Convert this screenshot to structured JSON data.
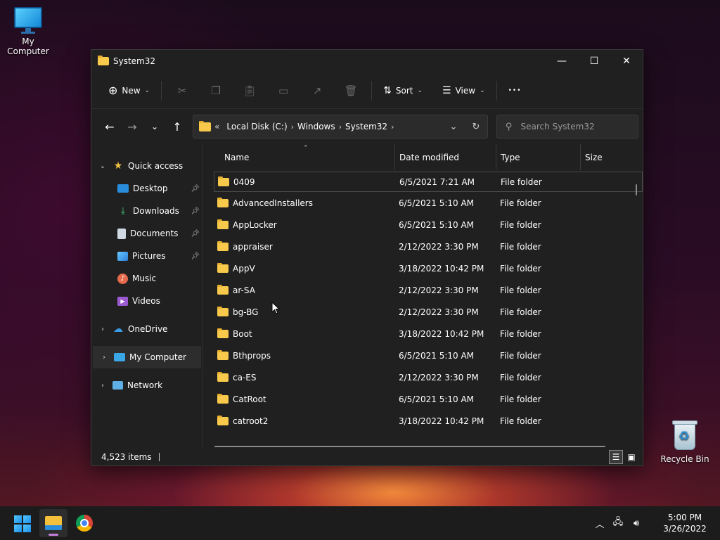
{
  "desktop": {
    "my_computer_label": "My Computer",
    "recycle_bin_label": "Recycle Bin"
  },
  "window": {
    "title": "System32",
    "minimize": "—",
    "maximize": "☐",
    "close": "✕"
  },
  "toolbar": {
    "new_label": "New",
    "sort_label": "Sort",
    "view_label": "View",
    "more_label": "•••"
  },
  "address": {
    "prefix": "«",
    "crumbs": [
      "Local Disk (C:)",
      "Windows",
      "System32"
    ],
    "search_placeholder": "Search System32"
  },
  "sidebar": {
    "quick_access": "Quick access",
    "items": [
      {
        "label": "Desktop"
      },
      {
        "label": "Downloads"
      },
      {
        "label": "Documents"
      },
      {
        "label": "Pictures"
      },
      {
        "label": "Music"
      },
      {
        "label": "Videos"
      }
    ],
    "onedrive": "OneDrive",
    "my_computer": "My Computer",
    "network": "Network"
  },
  "columns": {
    "name": "Name",
    "date": "Date modified",
    "type": "Type",
    "size": "Size"
  },
  "files": [
    {
      "name": "0409",
      "date": "6/5/2021 7:21 AM",
      "type": "File folder"
    },
    {
      "name": "AdvancedInstallers",
      "date": "6/5/2021 5:10 AM",
      "type": "File folder"
    },
    {
      "name": "AppLocker",
      "date": "6/5/2021 5:10 AM",
      "type": "File folder"
    },
    {
      "name": "appraiser",
      "date": "2/12/2022 3:30 PM",
      "type": "File folder"
    },
    {
      "name": "AppV",
      "date": "3/18/2022 10:42 PM",
      "type": "File folder"
    },
    {
      "name": "ar-SA",
      "date": "2/12/2022 3:30 PM",
      "type": "File folder"
    },
    {
      "name": "bg-BG",
      "date": "2/12/2022 3:30 PM",
      "type": "File folder"
    },
    {
      "name": "Boot",
      "date": "3/18/2022 10:42 PM",
      "type": "File folder"
    },
    {
      "name": "Bthprops",
      "date": "6/5/2021 5:10 AM",
      "type": "File folder"
    },
    {
      "name": "ca-ES",
      "date": "2/12/2022 3:30 PM",
      "type": "File folder"
    },
    {
      "name": "CatRoot",
      "date": "6/5/2021 5:10 AM",
      "type": "File folder"
    },
    {
      "name": "catroot2",
      "date": "3/18/2022 10:42 PM",
      "type": "File folder"
    }
  ],
  "status": {
    "item_count": "4,523 items"
  },
  "taskbar": {
    "time": "5:00 PM",
    "date": "3/26/2022"
  },
  "colors": {
    "folder": "#f8c94a",
    "window_bg": "#202020",
    "taskbar_bg": "#1c1c1c",
    "accent": "#55c7ff"
  }
}
